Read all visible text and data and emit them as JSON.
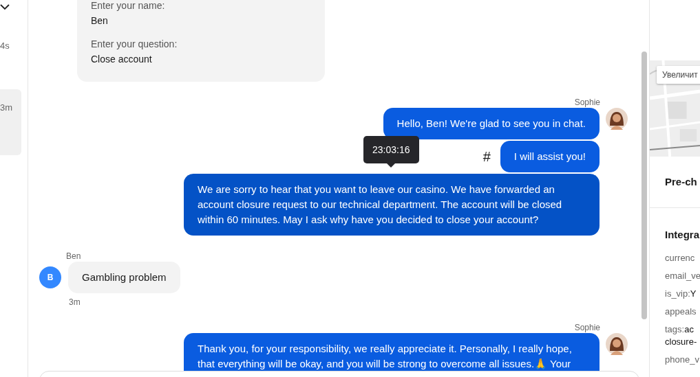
{
  "sidebar": {
    "items": [
      {
        "time": "4s",
        "selected": false
      },
      {
        "time": "3m",
        "selected": true
      }
    ]
  },
  "prechat": {
    "fields": [
      {
        "label": "Enter your name:",
        "value": "Ben"
      },
      {
        "label": "Enter your question:",
        "value": "Close account"
      }
    ]
  },
  "messages": [
    {
      "kind": "agent",
      "author": "Sophie",
      "bubbles": [
        {
          "text": "Hello, Ben! We're glad to see you in chat.",
          "hovered": false
        },
        {
          "text": "I will assist you!",
          "hovered": false,
          "mark": "#"
        },
        {
          "text": "We are sorry to hear that you want to leave our casino. We have forwarded an account closure request to our technical department. The account will be closed within 60 minutes. May I ask why have you decided to close your account?",
          "hovered": true,
          "tooltip": "23:03:16"
        }
      ]
    },
    {
      "kind": "visitor",
      "author": "Ben",
      "initial": "B",
      "time": "3m",
      "bubbles": [
        {
          "text": "Gambling problem",
          "hovered": false
        }
      ]
    },
    {
      "kind": "agent",
      "author": "Sophie",
      "bubbles": [
        {
          "text": "Thank you, for your responsibility, we really appreciate it. Personally, I really hope, that everything will be okay, and you will be strong to overcome all issues.🙏 Your",
          "hovered": false
        }
      ]
    }
  ],
  "details": {
    "zoom_button": "Увеличит",
    "sections": [
      {
        "title": "Pre-ch"
      },
      {
        "title": "Integra",
        "fields": [
          {
            "key": "currenc"
          },
          {
            "key": "email_ve"
          },
          {
            "key": "is_vip:",
            "value": "Y"
          },
          {
            "key": "appeals"
          },
          {
            "key": "tags:",
            "value": "ac",
            "continuation": "closure-"
          },
          {
            "key": "phone_v"
          }
        ]
      }
    ]
  }
}
